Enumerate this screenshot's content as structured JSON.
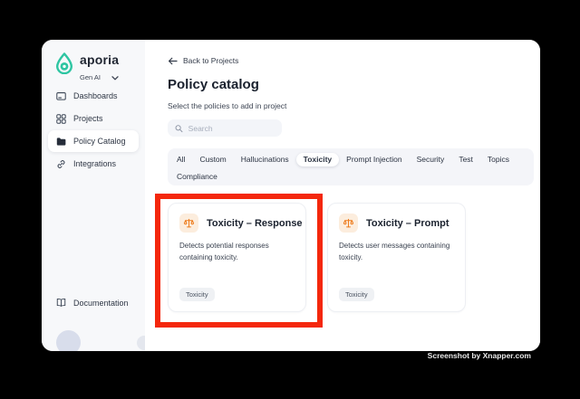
{
  "colors": {
    "brand_teal": "#2EC5A2",
    "highlight_red": "#F4270C",
    "policy_icon_orange": "#ED7D1F",
    "policy_icon_bg": "#FCEDDD",
    "sidebar_bg": "#F7F8FA"
  },
  "brand": {
    "name": "aporia",
    "workspace": "Gen AI"
  },
  "sidebar": {
    "items": [
      {
        "label": "Dashboards",
        "icon": "dashboard-icon",
        "active": false
      },
      {
        "label": "Projects",
        "icon": "grid-icon",
        "active": false
      },
      {
        "label": "Policy Catalog",
        "icon": "folder-icon",
        "active": true
      },
      {
        "label": "Integrations",
        "icon": "link-icon",
        "active": false
      }
    ],
    "documentation_label": "Documentation"
  },
  "main": {
    "back_link": "Back to Projects",
    "title": "Policy catalog",
    "subtitle": "Select the policies to add in project",
    "search_placeholder": "Search",
    "tabs": {
      "active": "Toxicity",
      "row1": [
        "All",
        "Custom",
        "Hallucinations",
        "Toxicity",
        "Prompt Injection",
        "Security",
        "Test",
        "Topics"
      ],
      "row2": [
        "Compliance"
      ]
    },
    "cards": [
      {
        "title": "Toxicity – Response",
        "description": "Detects potential responses containing toxicity.",
        "tag": "Toxicity",
        "icon": "scales-icon",
        "highlighted": true
      },
      {
        "title": "Toxicity – Prompt",
        "description": "Detects user messages containing toxicity.",
        "tag": "Toxicity",
        "icon": "scales-icon",
        "highlighted": false
      }
    ]
  },
  "watermark": "Screenshot by Xnapper.com"
}
